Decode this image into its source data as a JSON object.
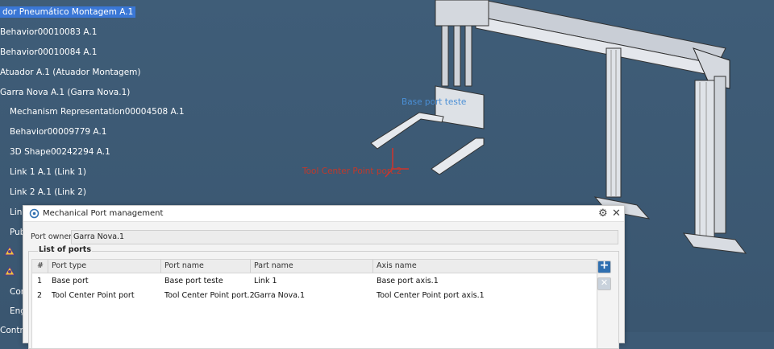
{
  "tree": {
    "items": [
      {
        "label": "dor Pneumático Montagem A.1",
        "selected": true
      },
      {
        "label": "Behavior00010083 A.1"
      },
      {
        "label": "Behavior00010084 A.1"
      },
      {
        "label": "Atuador A.1 (Atuador Montagem)"
      },
      {
        "label": "Garra Nova A.1 (Garra Nova.1)"
      },
      {
        "label": "Mechanism Representation00004508 A.1"
      },
      {
        "label": "Behavior00009779 A.1"
      },
      {
        "label": "3D Shape00242294 A.1"
      },
      {
        "label": "Link 1 A.1 (Link 1)"
      },
      {
        "label": "Link 2 A.1 (Link 2)"
      },
      {
        "label": "Link"
      },
      {
        "label": "Pub"
      },
      {
        "label": "Con"
      },
      {
        "label": "Eng"
      },
      {
        "label": "Contro"
      }
    ]
  },
  "scene": {
    "base_port_label": "Base port teste",
    "tcp_label": "Tool Center Point port.2",
    "tcp_color": "#c0392b",
    "base_port_color": "#4a8fd6"
  },
  "dialog": {
    "title": "Mechanical Port management",
    "port_owner_label": "Port owner:",
    "port_owner_value": "Garra Nova.1",
    "group_label": "List of ports",
    "columns": [
      "#",
      "Port type",
      "Port name",
      "Part name",
      "Axis name"
    ],
    "rows": [
      {
        "num": "1",
        "type": "Base port",
        "name": "Base port teste",
        "part": "Link 1",
        "axis": "Base port axis.1"
      },
      {
        "num": "2",
        "type": "Tool Center Point port",
        "name": "Tool Center Point port.2",
        "part": "Garra Nova.1",
        "axis": "Tool Center Point port axis.1"
      }
    ],
    "add_icon": "plus-icon",
    "remove_icon": "close-icon",
    "settings_icon": "gear-icon",
    "close_icon": "close-icon"
  }
}
